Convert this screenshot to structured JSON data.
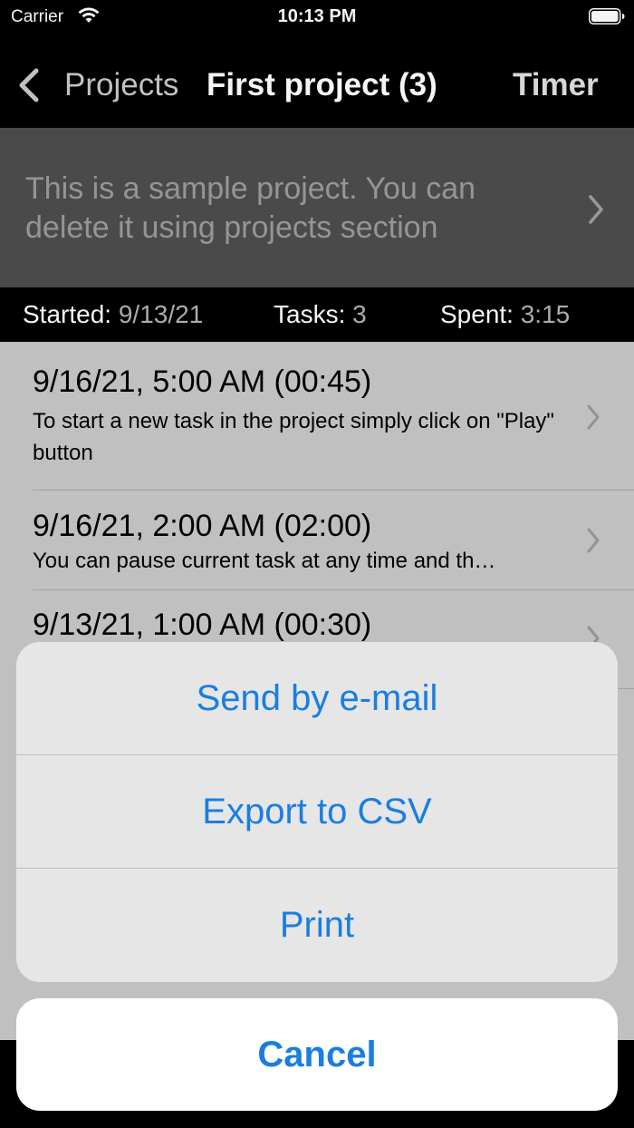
{
  "status_bar": {
    "carrier": "Carrier",
    "time": "10:13 PM"
  },
  "nav": {
    "back_label": "Projects",
    "title": "First project (3)",
    "right_label": "Timer"
  },
  "description": {
    "text": "This is a sample project. You can delete it using projects section"
  },
  "stats": {
    "started_label": "Started:",
    "started_value": "9/13/21",
    "tasks_label": "Tasks:",
    "tasks_value": "3",
    "spent_label": "Spent:",
    "spent_value": "3:15"
  },
  "tasks": [
    {
      "title": "9/16/21, 5:00 AM (00:45)",
      "description": "To start a new task in the project simply click on \"Play\" button"
    },
    {
      "title": "9/16/21, 2:00 AM (02:00)",
      "description": "You can pause current task at any time and th…"
    },
    {
      "title": "9/13/21, 1:00 AM (00:30)",
      "description": ""
    }
  ],
  "action_sheet": {
    "actions": [
      "Send by e-mail",
      "Export to CSV",
      "Print"
    ],
    "cancel": "Cancel"
  },
  "colors": {
    "accent": "#1a7ee0",
    "description_bg": "#4e4e4e",
    "list_bg": "#c8c8c8"
  }
}
